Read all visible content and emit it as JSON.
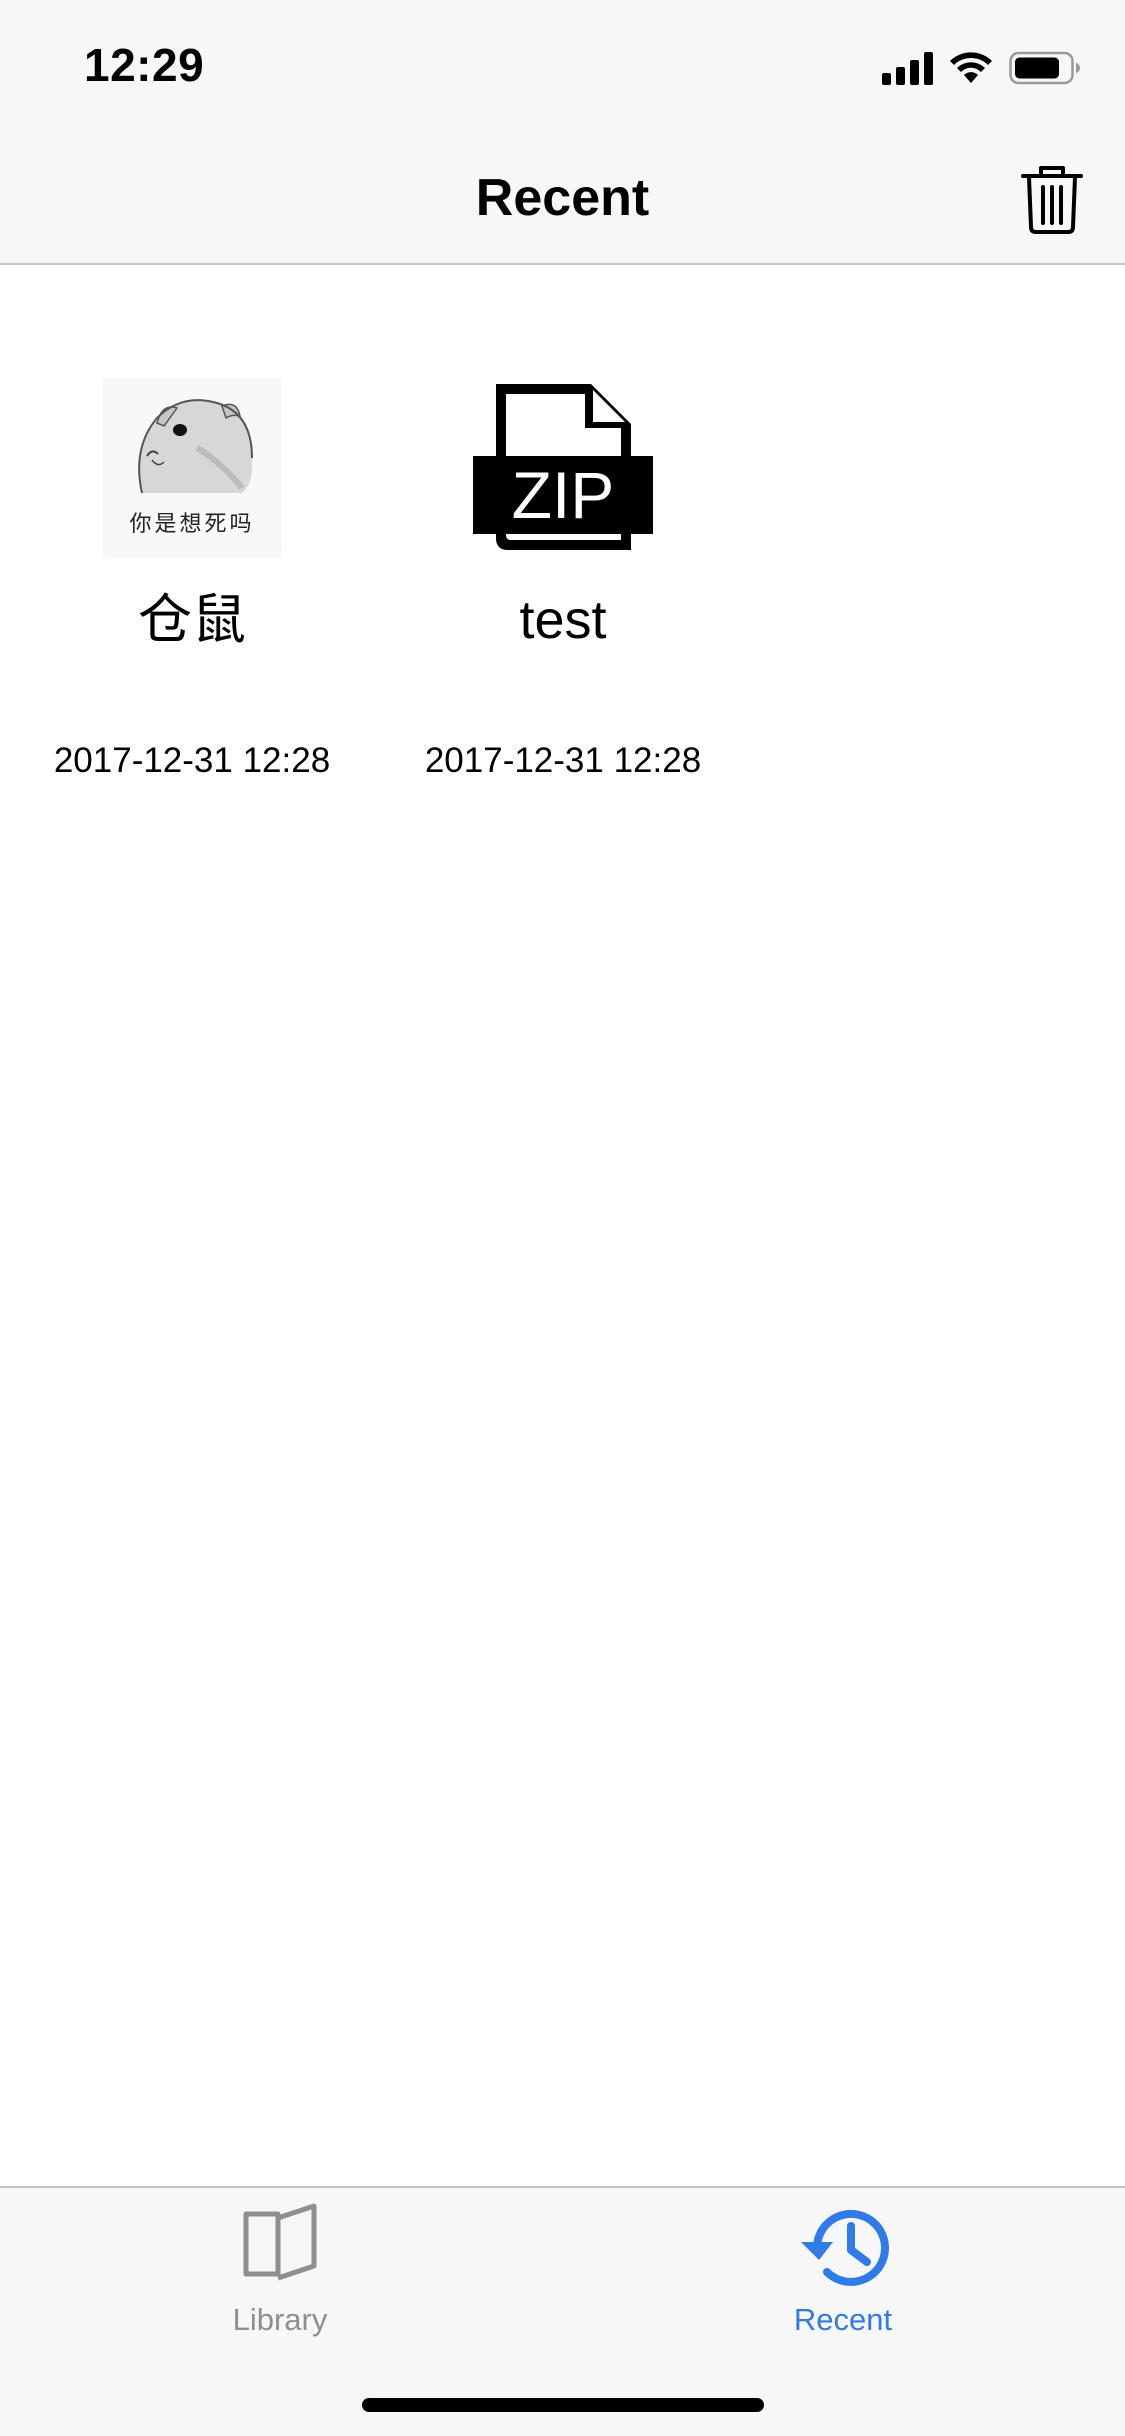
{
  "status_bar": {
    "time": "12:29",
    "icons": [
      "signal-icon",
      "wifi-icon",
      "battery-icon"
    ]
  },
  "nav": {
    "title": "Recent",
    "trash_icon": "trash-icon"
  },
  "items": [
    {
      "name": "仓鼠",
      "date": "2017-12-31 12:28",
      "thumbnail": "hamster-image",
      "thumbnail_caption": "你是想死吗"
    },
    {
      "name": "test",
      "date": "2017-12-31 12:28",
      "thumbnail": "zip-file-icon",
      "thumbnail_text": "ZIP"
    }
  ],
  "tabbar": {
    "tabs": [
      {
        "label": "Library",
        "icon": "book-icon",
        "selected": false
      },
      {
        "label": "Recent",
        "icon": "history-clock-icon",
        "selected": true
      }
    ],
    "accent_color": "#2f7bea",
    "inactive_color": "#8e8e93"
  }
}
